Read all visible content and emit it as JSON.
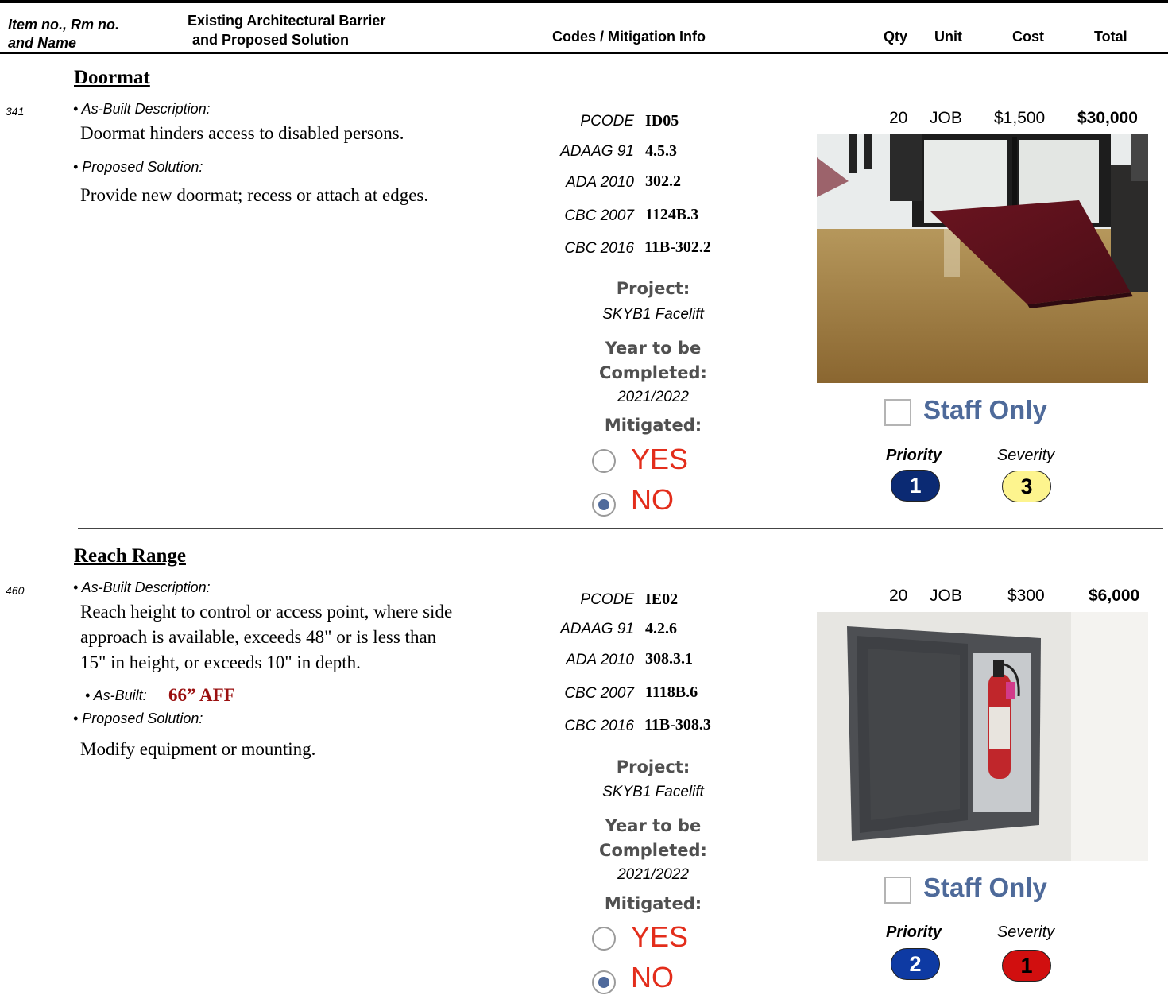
{
  "header": {
    "col1_line1": "Item no., Rm no.",
    "col1_line2": "and Name",
    "col2_line1": "Existing Architectural Barrier",
    "col2_line2": "and Proposed Solution",
    "col3": "Codes / Mitigation Info",
    "qty": "Qty",
    "unit": "Unit",
    "cost": "Cost",
    "total": "Total"
  },
  "items": [
    {
      "title": "Doormat",
      "item_no": "341",
      "asbuilt_desc_label": "• As-Built Description:",
      "asbuilt_desc": "Doormat hinders access to disabled persons.",
      "proposed_label": "• Proposed Solution:",
      "proposed": "Provide new doormat; recess or attach at edges.",
      "codes": [
        {
          "label": "PCODE",
          "value": "ID05"
        },
        {
          "label": "ADAAG 91",
          "value": "4.5.3"
        },
        {
          "label": "ADA 2010",
          "value": "302.2"
        },
        {
          "label": "CBC 2007",
          "value": "1124B.3"
        },
        {
          "label": "CBC 2016",
          "value": "11B-302.2"
        }
      ],
      "project_label": "Project:",
      "project": "SKYB1 Facelift",
      "year_label_1": "Year to be",
      "year_label_2": "Completed:",
      "year": "2021/2022",
      "mitigated_label": "Mitigated:",
      "yes": "YES",
      "no": "NO",
      "mitigated": false,
      "qty": "20",
      "unit": "JOB",
      "cost": "$1,500",
      "total": "$30,000",
      "staff_only": "Staff Only",
      "staff_only_checked": false,
      "priority_label": "Priority",
      "severity_label": "Severity",
      "priority": "1",
      "severity": "3",
      "priority_color": "#0b2a73",
      "severity_color": "#fdf48e"
    },
    {
      "title": "Reach Range",
      "item_no": "460",
      "asbuilt_desc_label": "• As-Built Description:",
      "asbuilt_desc_lines": [
        "Reach height to control or access point, where side",
        "approach is available, exceeds 48\" or is less than",
        "15\" in height, or exceeds 10\" in depth."
      ],
      "asbuilt_label": "• As-Built:",
      "asbuilt_value": "66” AFF",
      "proposed_label": "• Proposed Solution:",
      "proposed": "Modify equipment or mounting.",
      "codes": [
        {
          "label": "PCODE",
          "value": "IE02"
        },
        {
          "label": "ADAAG 91",
          "value": "4.2.6"
        },
        {
          "label": "ADA 2010",
          "value": "308.3.1"
        },
        {
          "label": "CBC 2007",
          "value": "1118B.6"
        },
        {
          "label": "CBC 2016",
          "value": "11B-308.3"
        }
      ],
      "project_label": "Project:",
      "project": "SKYB1 Facelift",
      "year_label_1": "Year to be",
      "year_label_2": "Completed:",
      "year": "2021/2022",
      "mitigated_label": "Mitigated:",
      "yes": "YES",
      "no": "NO",
      "mitigated": false,
      "qty": "20",
      "unit": "JOB",
      "cost": "$300",
      "total": "$6,000",
      "staff_only": "Staff Only",
      "staff_only_checked": false,
      "priority_label": "Priority",
      "severity_label": "Severity",
      "priority": "2",
      "severity": "1",
      "priority_color": "#0e3aa3",
      "severity_color": "#d10f0f"
    }
  ]
}
